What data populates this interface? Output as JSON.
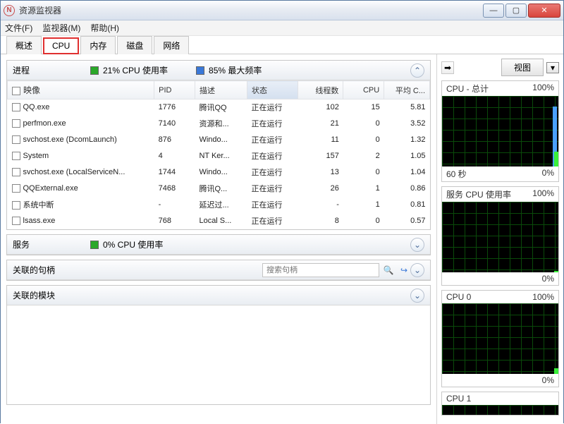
{
  "window": {
    "title": "资源监视器"
  },
  "menu": {
    "file": "文件(F)",
    "monitor": "监视器(M)",
    "help": "帮助(H)"
  },
  "tabs": {
    "overview": "概述",
    "cpu": "CPU",
    "memory": "内存",
    "disk": "磁盘",
    "network": "网络"
  },
  "panels": {
    "processes": {
      "title": "进程",
      "cpu_usage": "21% CPU 使用率",
      "max_freq": "85% 最大频率"
    },
    "services": {
      "title": "服务",
      "cpu_usage": "0% CPU 使用率"
    },
    "handles": {
      "title": "关联的句柄",
      "search_placeholder": "搜索句柄"
    },
    "modules": {
      "title": "关联的模块"
    }
  },
  "columns": {
    "image": "映像",
    "pid": "PID",
    "desc": "描述",
    "status": "状态",
    "threads": "线程数",
    "cpu": "CPU",
    "avg": "平均 C..."
  },
  "rows": [
    {
      "image": "QQ.exe",
      "pid": "1776",
      "desc": "腾讯QQ",
      "status": "正在运行",
      "threads": "102",
      "cpu": "15",
      "avg": "5.81"
    },
    {
      "image": "perfmon.exe",
      "pid": "7140",
      "desc": "资源和...",
      "status": "正在运行",
      "threads": "21",
      "cpu": "0",
      "avg": "3.52"
    },
    {
      "image": "svchost.exe (DcomLaunch)",
      "pid": "876",
      "desc": "Windo...",
      "status": "正在运行",
      "threads": "11",
      "cpu": "0",
      "avg": "1.32"
    },
    {
      "image": "System",
      "pid": "4",
      "desc": "NT Ker...",
      "status": "正在运行",
      "threads": "157",
      "cpu": "2",
      "avg": "1.05"
    },
    {
      "image": "svchost.exe (LocalServiceN...",
      "pid": "1744",
      "desc": "Windo...",
      "status": "正在运行",
      "threads": "13",
      "cpu": "0",
      "avg": "1.04"
    },
    {
      "image": "QQExternal.exe",
      "pid": "7468",
      "desc": "腾讯Q...",
      "status": "正在运行",
      "threads": "26",
      "cpu": "1",
      "avg": "0.86"
    },
    {
      "image": "系统中断",
      "pid": "-",
      "desc": "延迟过...",
      "status": "正在运行",
      "threads": "-",
      "cpu": "1",
      "avg": "0.81"
    },
    {
      "image": "lsass.exe",
      "pid": "768",
      "desc": "Local S...",
      "status": "正在运行",
      "threads": "8",
      "cpu": "0",
      "avg": "0.57"
    }
  ],
  "right": {
    "view_label": "视图",
    "graphs": [
      {
        "title": "CPU - 总计",
        "max": "100%",
        "xlabel": "60 秒",
        "min": "0%"
      },
      {
        "title": "服务 CPU 使用率",
        "max": "100%",
        "xlabel": "",
        "min": "0%"
      },
      {
        "title": "CPU 0",
        "max": "100%",
        "xlabel": "",
        "min": "0%"
      },
      {
        "title": "CPU 1",
        "max": "",
        "xlabel": "",
        "min": ""
      }
    ]
  },
  "chart_data": [
    {
      "type": "line",
      "title": "CPU - 总计",
      "ylim": [
        0,
        100
      ],
      "xlabel": "60 秒",
      "series": [
        {
          "name": "cpu",
          "values": [
            21
          ]
        },
        {
          "name": "freq",
          "values": [
            85
          ]
        }
      ]
    },
    {
      "type": "line",
      "title": "服务 CPU 使用率",
      "ylim": [
        0,
        100
      ],
      "series": [
        {
          "name": "cpu",
          "values": [
            0
          ]
        }
      ]
    },
    {
      "type": "line",
      "title": "CPU 0",
      "ylim": [
        0,
        100
      ],
      "series": [
        {
          "name": "cpu",
          "values": [
            5
          ]
        }
      ]
    },
    {
      "type": "line",
      "title": "CPU 1",
      "ylim": [
        0,
        100
      ],
      "series": [
        {
          "name": "cpu",
          "values": [
            0
          ]
        }
      ]
    }
  ]
}
